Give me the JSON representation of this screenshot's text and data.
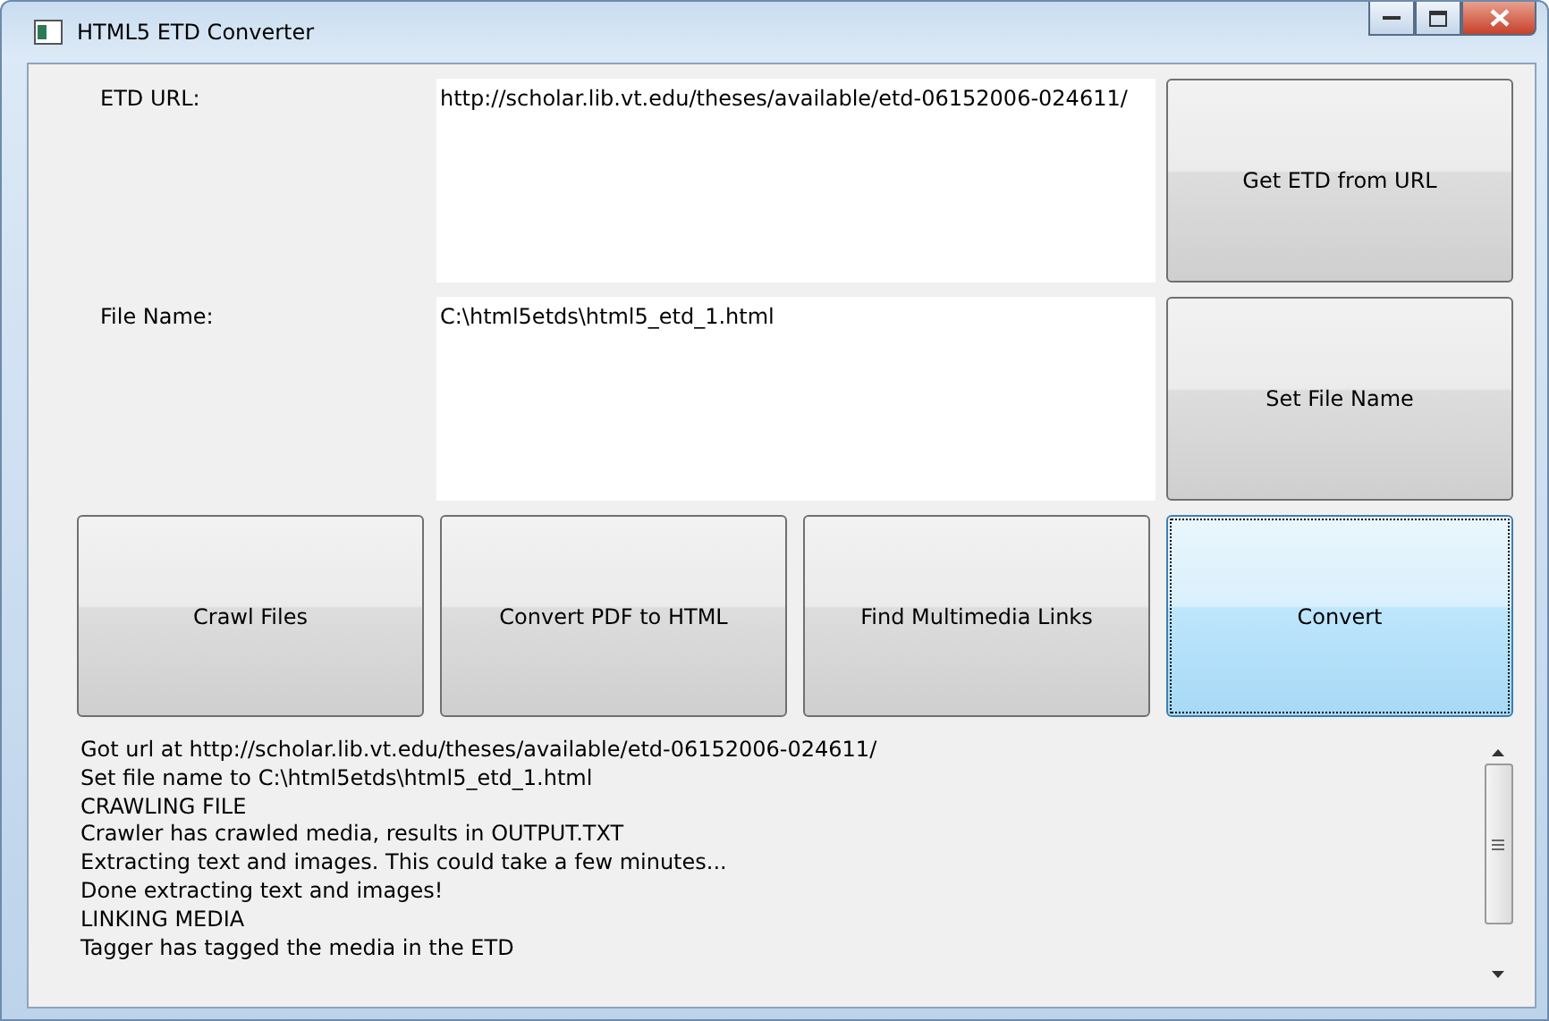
{
  "window": {
    "title": "HTML5 ETD Converter"
  },
  "fields": [
    {
      "label": "ETD URL:",
      "value": "http://scholar.lib.vt.edu/theses/available/etd-06152006-024611/",
      "button": {
        "label": "Get ETD from URL",
        "focused": false
      }
    },
    {
      "label": "File Name:",
      "value": "C:\\html5etds\\html5_etd_1.html",
      "button": {
        "label": "Set File Name",
        "focused": false
      }
    }
  ],
  "actions": [
    {
      "label": "Crawl Files",
      "focused": false
    },
    {
      "label": "Convert PDF to HTML",
      "focused": false
    },
    {
      "label": "Find Multimedia Links",
      "focused": false
    },
    {
      "label": "Convert",
      "focused": true
    }
  ],
  "log": [
    "Got url at http://scholar.lib.vt.edu/theses/available/etd-06152006-024611/",
    "Set file name to C:\\html5etds\\html5_etd_1.html",
    "CRAWLING FILE",
    "Crawler has crawled media, results in OUTPUT.TXT",
    "Extracting text and images. This could take a few minutes...",
    "Done extracting text and images!",
    "LINKING MEDIA",
    "Tagger has tagged the media in the ETD"
  ]
}
